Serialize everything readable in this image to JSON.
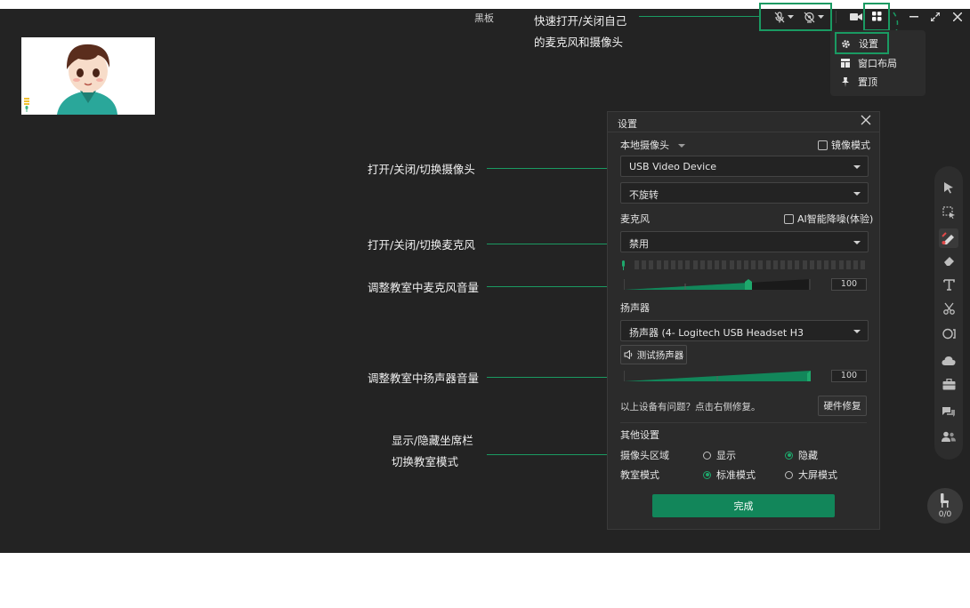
{
  "topbar": {
    "label": "黑板"
  },
  "menu": {
    "items": [
      {
        "label": "设置"
      },
      {
        "label": "窗口布局"
      },
      {
        "label": "置顶"
      }
    ]
  },
  "annotations": {
    "quick_toggle_1": "快速打开/关闭自己",
    "quick_toggle_2": "的麦克风和摄像头",
    "camera": "打开/关闭/切换摄像头",
    "mic": "打开/关闭/切换麦克风",
    "mic_volume": "调整教室中麦克风音量",
    "speaker_volume": "调整教室中扬声器音量",
    "seat": "显示/隐藏坐席栏",
    "mode": "切换教室模式"
  },
  "settings": {
    "title": "设置",
    "local_camera": "本地摄像头",
    "mirror": "镜像模式",
    "camera_device": "USB Video Device",
    "rotation": "不旋转",
    "microphone": "麦克风",
    "ai_noise": "AI智能降噪(体验)",
    "mic_device": "禁用",
    "mic_volume": "100",
    "speaker": "扬声器",
    "speaker_device": "扬声器 (4- Logitech USB Headset H3",
    "test_speaker": "测试扬声器",
    "speaker_volume": "100",
    "problem_hint": "以上设备有问题？点击右侧修复。",
    "repair": "硬件修复",
    "other": "其他设置",
    "camera_area": "摄像头区域",
    "show": "显示",
    "hide": "隐藏",
    "classroom_mode": "教室模式",
    "standard": "标准模式",
    "bigscreen": "大屏模式",
    "done": "完成"
  },
  "seat": {
    "count": "0/0"
  },
  "accent": "#12865a"
}
